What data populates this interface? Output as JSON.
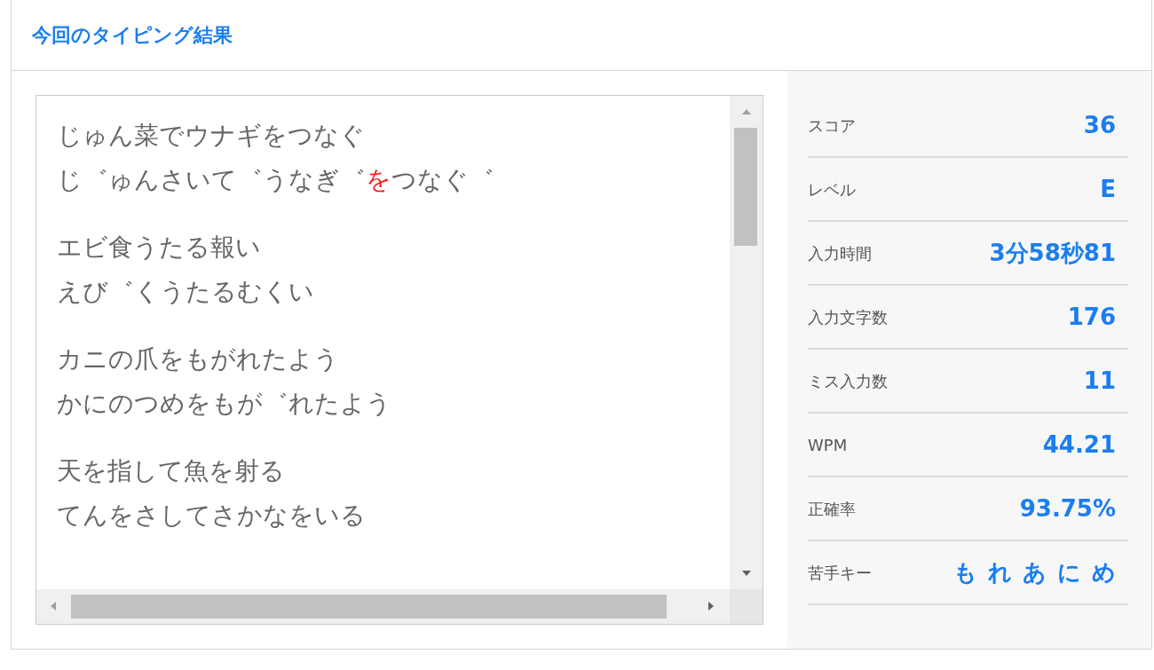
{
  "title": "今回のタイピング結果",
  "entries": [
    {
      "text": "じゅん菜でウナギをつなぐ",
      "reading": [
        {
          "text": "じ゛ゅんさいて゛うなぎ゛",
          "miss": false
        },
        {
          "text": "を",
          "miss": true
        },
        {
          "text": "つなぐ゛",
          "miss": false
        }
      ]
    },
    {
      "text": "エビ食うたる報い",
      "reading": [
        {
          "text": "えび゛くうたるむくい",
          "miss": false
        }
      ]
    },
    {
      "text": "カニの爪をもがれたよう",
      "reading": [
        {
          "text": "かにのつめをもが゛れたよう",
          "miss": false
        }
      ]
    },
    {
      "text": "天を指して魚を射る",
      "reading": [
        {
          "text": "てんをさしてさかなをいる",
          "miss": false
        }
      ]
    }
  ],
  "stats": [
    {
      "label": "スコア",
      "value": "36"
    },
    {
      "label": "レベル",
      "value": "E"
    },
    {
      "label": "入力時間",
      "value": "3分58秒81"
    },
    {
      "label": "入力文字数",
      "value": "176"
    },
    {
      "label": "ミス入力数",
      "value": "11"
    },
    {
      "label": "WPM",
      "value": "44.21"
    },
    {
      "label": "正確率",
      "value": "93.75%"
    },
    {
      "label": "苦手キー",
      "keys": [
        "も",
        "れ",
        "あ",
        "に",
        "め"
      ]
    }
  ]
}
